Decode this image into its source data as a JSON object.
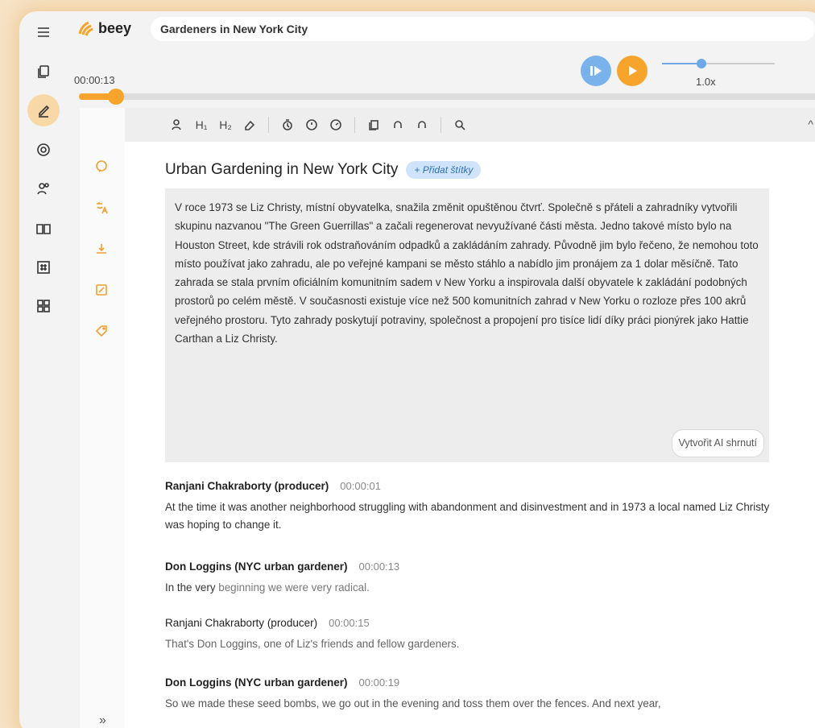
{
  "app": {
    "logo": "beey",
    "title": "Gardeners in New York City"
  },
  "player": {
    "timecode": "00:00:13",
    "speed": "1.0x",
    "speed_level": 0.35,
    "progress": 0.05
  },
  "rail": {
    "items": [
      {
        "name": "menu-icon"
      },
      {
        "name": "documents-icon"
      },
      {
        "name": "edit-icon",
        "active": true
      },
      {
        "name": "settings-icon"
      },
      {
        "name": "speakers-icon"
      },
      {
        "name": "dictionary-icon"
      },
      {
        "name": "hashtag-icon"
      },
      {
        "name": "apps-icon"
      }
    ]
  },
  "side_tools": [
    "chat-icon",
    "translate-icon",
    "download-icon",
    "edit-note-icon",
    "tag-icon"
  ],
  "toolbar": {
    "h1": "H₁",
    "h2": "H₂"
  },
  "document": {
    "title": "Urban Gardening in New York City",
    "tag_button": "+ Přidat štítky",
    "summary": "V roce 1973 se Liz Christy, místní obyvatelka, snažila změnit opuštěnou čtvrť. Společně s přáteli a zahradníky vytvořili skupinu nazvanou \"The Green Guerrillas\" a začali regenerovat nevyužívané části města. Jedno takové místo bylo na Houston Street, kde strávili rok odstraňováním odpadků a zakládáním zahrady. Původně jim bylo řečeno, že nemohou toto místo používat jako zahradu, ale po veřejné kampani se město stáhlo a nabídlo jim pronájem za 1 dolar měsíčně. Tato zahrada se stala prvním oficiálním komunitním sadem v New Yorku a inspirovala další obyvatele k zakládání podobných prostorů po celém městě. V současnosti existuje více než 500 komunitních zahrad v New Yorku o rozloze přes 100 akrů veřejného prostoru. Tyto zahrady poskytují potraviny, společnost a propojení pro tisíce lidí díky práci pionýrek jako Hattie Carthan a Liz Christy.",
    "ai_button": "Vytvořit AI shrnutí",
    "segments": [
      {
        "speaker": "Ranjani Chakraborty (producer)",
        "time": "00:00:01",
        "text": "At the time it was another neighborhood struggling with abandonment and disinvestment and in 1973 a local named Liz Christy was hoping to change it."
      },
      {
        "speaker": "Don Loggins (NYC urban gardener)",
        "time": "00:00:13",
        "text_a": "In the very",
        "text_b": " beginning we were very radical."
      },
      {
        "speaker": "Ranjani Chakraborty (producer)",
        "time": "00:00:15",
        "text": "That's Don Loggins, one of Liz's friends and fellow gardeners."
      },
      {
        "speaker": "Don Loggins (NYC urban gardener)",
        "time": "00:00:19",
        "text": "So we made these seed bombs, we go out in the evening and toss them over the fences. And next year,"
      }
    ]
  },
  "collapse": "»"
}
